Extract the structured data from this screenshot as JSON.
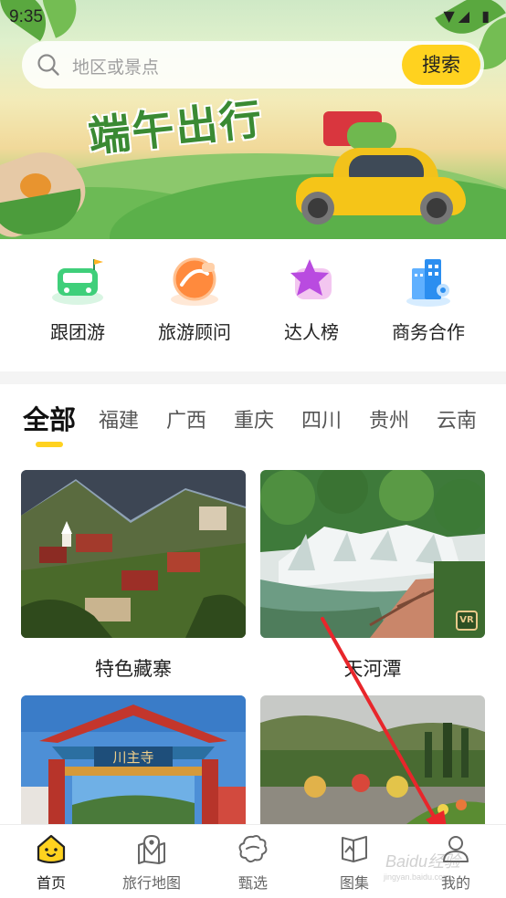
{
  "status_bar": {
    "time": "9:35",
    "icons_text": "▼◢ ▮"
  },
  "search": {
    "placeholder": "地区或景点",
    "button_label": "搜索"
  },
  "banner": {
    "title": "端午出行"
  },
  "quick_nav": [
    {
      "label": "跟团游",
      "icon": "bus-icon"
    },
    {
      "label": "旅游顾问",
      "icon": "advisor-icon"
    },
    {
      "label": "达人榜",
      "icon": "star-icon"
    },
    {
      "label": "商务合作",
      "icon": "building-icon"
    }
  ],
  "tabs": [
    {
      "label": "全部",
      "active": true
    },
    {
      "label": "福建"
    },
    {
      "label": "广西"
    },
    {
      "label": "重庆"
    },
    {
      "label": "四川"
    },
    {
      "label": "贵州"
    },
    {
      "label": "云南"
    }
  ],
  "cards": [
    {
      "caption": "特色藏寨"
    },
    {
      "caption": "天河潭",
      "badge": "VR"
    },
    {
      "caption": ""
    },
    {
      "caption": ""
    }
  ],
  "gate_sign": "川主寺",
  "bottom_nav": [
    {
      "label": "首页",
      "icon": "home-face-icon",
      "active": true
    },
    {
      "label": "旅行地图",
      "icon": "map-pin-icon"
    },
    {
      "label": "甄选",
      "icon": "flower-icon"
    },
    {
      "label": "图集",
      "icon": "album-icon"
    },
    {
      "label": "我的",
      "icon": "user-icon"
    }
  ],
  "watermark": {
    "text": "Baidu经验",
    "sub": "jingyan.baidu.com"
  },
  "colors": {
    "accent": "#ffd21f",
    "annotation_arrow": "#e8262b"
  }
}
